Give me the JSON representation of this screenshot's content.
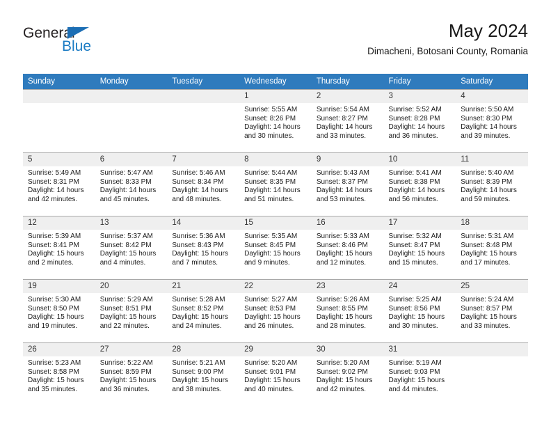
{
  "brand": {
    "name_part1": "General",
    "name_part2": "Blue",
    "triangle_color": "#1c6eb4",
    "blue_color": "#1c7cc4"
  },
  "header": {
    "title": "May 2024",
    "subtitle": "Dimacheni, Botosani County, Romania"
  },
  "colors": {
    "header_row_background": "#2f7bbd",
    "header_row_text": "#ffffff",
    "daynum_background": "#efefef",
    "grid_line": "#a8a8a8"
  },
  "weekday_headers": [
    "Sunday",
    "Monday",
    "Tuesday",
    "Wednesday",
    "Thursday",
    "Friday",
    "Saturday"
  ],
  "weeks": [
    [
      {
        "day": "",
        "lines": []
      },
      {
        "day": "",
        "lines": []
      },
      {
        "day": "",
        "lines": []
      },
      {
        "day": "1",
        "lines": [
          "Sunrise: 5:55 AM",
          "Sunset: 8:26 PM",
          "Daylight: 14 hours",
          "and 30 minutes."
        ]
      },
      {
        "day": "2",
        "lines": [
          "Sunrise: 5:54 AM",
          "Sunset: 8:27 PM",
          "Daylight: 14 hours",
          "and 33 minutes."
        ]
      },
      {
        "day": "3",
        "lines": [
          "Sunrise: 5:52 AM",
          "Sunset: 8:28 PM",
          "Daylight: 14 hours",
          "and 36 minutes."
        ]
      },
      {
        "day": "4",
        "lines": [
          "Sunrise: 5:50 AM",
          "Sunset: 8:30 PM",
          "Daylight: 14 hours",
          "and 39 minutes."
        ]
      }
    ],
    [
      {
        "day": "5",
        "lines": [
          "Sunrise: 5:49 AM",
          "Sunset: 8:31 PM",
          "Daylight: 14 hours",
          "and 42 minutes."
        ]
      },
      {
        "day": "6",
        "lines": [
          "Sunrise: 5:47 AM",
          "Sunset: 8:33 PM",
          "Daylight: 14 hours",
          "and 45 minutes."
        ]
      },
      {
        "day": "7",
        "lines": [
          "Sunrise: 5:46 AM",
          "Sunset: 8:34 PM",
          "Daylight: 14 hours",
          "and 48 minutes."
        ]
      },
      {
        "day": "8",
        "lines": [
          "Sunrise: 5:44 AM",
          "Sunset: 8:35 PM",
          "Daylight: 14 hours",
          "and 51 minutes."
        ]
      },
      {
        "day": "9",
        "lines": [
          "Sunrise: 5:43 AM",
          "Sunset: 8:37 PM",
          "Daylight: 14 hours",
          "and 53 minutes."
        ]
      },
      {
        "day": "10",
        "lines": [
          "Sunrise: 5:41 AM",
          "Sunset: 8:38 PM",
          "Daylight: 14 hours",
          "and 56 minutes."
        ]
      },
      {
        "day": "11",
        "lines": [
          "Sunrise: 5:40 AM",
          "Sunset: 8:39 PM",
          "Daylight: 14 hours",
          "and 59 minutes."
        ]
      }
    ],
    [
      {
        "day": "12",
        "lines": [
          "Sunrise: 5:39 AM",
          "Sunset: 8:41 PM",
          "Daylight: 15 hours",
          "and 2 minutes."
        ]
      },
      {
        "day": "13",
        "lines": [
          "Sunrise: 5:37 AM",
          "Sunset: 8:42 PM",
          "Daylight: 15 hours",
          "and 4 minutes."
        ]
      },
      {
        "day": "14",
        "lines": [
          "Sunrise: 5:36 AM",
          "Sunset: 8:43 PM",
          "Daylight: 15 hours",
          "and 7 minutes."
        ]
      },
      {
        "day": "15",
        "lines": [
          "Sunrise: 5:35 AM",
          "Sunset: 8:45 PM",
          "Daylight: 15 hours",
          "and 9 minutes."
        ]
      },
      {
        "day": "16",
        "lines": [
          "Sunrise: 5:33 AM",
          "Sunset: 8:46 PM",
          "Daylight: 15 hours",
          "and 12 minutes."
        ]
      },
      {
        "day": "17",
        "lines": [
          "Sunrise: 5:32 AM",
          "Sunset: 8:47 PM",
          "Daylight: 15 hours",
          "and 15 minutes."
        ]
      },
      {
        "day": "18",
        "lines": [
          "Sunrise: 5:31 AM",
          "Sunset: 8:48 PM",
          "Daylight: 15 hours",
          "and 17 minutes."
        ]
      }
    ],
    [
      {
        "day": "19",
        "lines": [
          "Sunrise: 5:30 AM",
          "Sunset: 8:50 PM",
          "Daylight: 15 hours",
          "and 19 minutes."
        ]
      },
      {
        "day": "20",
        "lines": [
          "Sunrise: 5:29 AM",
          "Sunset: 8:51 PM",
          "Daylight: 15 hours",
          "and 22 minutes."
        ]
      },
      {
        "day": "21",
        "lines": [
          "Sunrise: 5:28 AM",
          "Sunset: 8:52 PM",
          "Daylight: 15 hours",
          "and 24 minutes."
        ]
      },
      {
        "day": "22",
        "lines": [
          "Sunrise: 5:27 AM",
          "Sunset: 8:53 PM",
          "Daylight: 15 hours",
          "and 26 minutes."
        ]
      },
      {
        "day": "23",
        "lines": [
          "Sunrise: 5:26 AM",
          "Sunset: 8:55 PM",
          "Daylight: 15 hours",
          "and 28 minutes."
        ]
      },
      {
        "day": "24",
        "lines": [
          "Sunrise: 5:25 AM",
          "Sunset: 8:56 PM",
          "Daylight: 15 hours",
          "and 30 minutes."
        ]
      },
      {
        "day": "25",
        "lines": [
          "Sunrise: 5:24 AM",
          "Sunset: 8:57 PM",
          "Daylight: 15 hours",
          "and 33 minutes."
        ]
      }
    ],
    [
      {
        "day": "26",
        "lines": [
          "Sunrise: 5:23 AM",
          "Sunset: 8:58 PM",
          "Daylight: 15 hours",
          "and 35 minutes."
        ]
      },
      {
        "day": "27",
        "lines": [
          "Sunrise: 5:22 AM",
          "Sunset: 8:59 PM",
          "Daylight: 15 hours",
          "and 36 minutes."
        ]
      },
      {
        "day": "28",
        "lines": [
          "Sunrise: 5:21 AM",
          "Sunset: 9:00 PM",
          "Daylight: 15 hours",
          "and 38 minutes."
        ]
      },
      {
        "day": "29",
        "lines": [
          "Sunrise: 5:20 AM",
          "Sunset: 9:01 PM",
          "Daylight: 15 hours",
          "and 40 minutes."
        ]
      },
      {
        "day": "30",
        "lines": [
          "Sunrise: 5:20 AM",
          "Sunset: 9:02 PM",
          "Daylight: 15 hours",
          "and 42 minutes."
        ]
      },
      {
        "day": "31",
        "lines": [
          "Sunrise: 5:19 AM",
          "Sunset: 9:03 PM",
          "Daylight: 15 hours",
          "and 44 minutes."
        ]
      },
      {
        "day": "",
        "lines": []
      }
    ]
  ]
}
